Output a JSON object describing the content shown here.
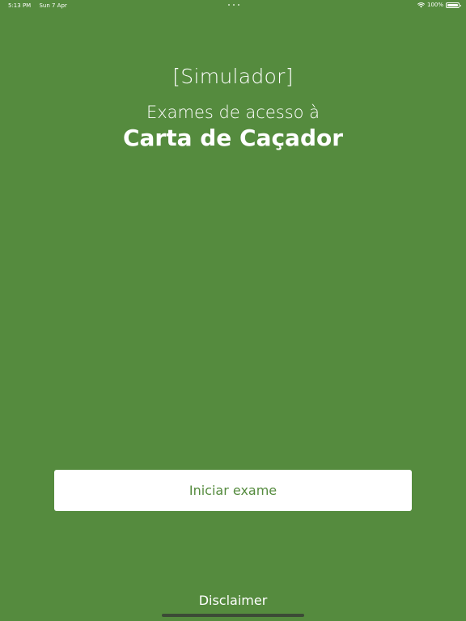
{
  "status_bar": {
    "time": "5:13 PM",
    "date": "Sun 7 Apr",
    "battery": "100%",
    "icons": [
      "wifi-icon",
      "battery-icon"
    ]
  },
  "header": {
    "label": "[Simulador]",
    "subtitle": "Exames de acesso à",
    "title": "Carta de Caçador"
  },
  "actions": {
    "start_label": "Iniciar exame",
    "disclaimer_label": "Disclaimer"
  },
  "colors": {
    "background": "#558b3e",
    "button_background": "#ffffff",
    "button_text": "#558b3e",
    "text": "#ffffff"
  }
}
